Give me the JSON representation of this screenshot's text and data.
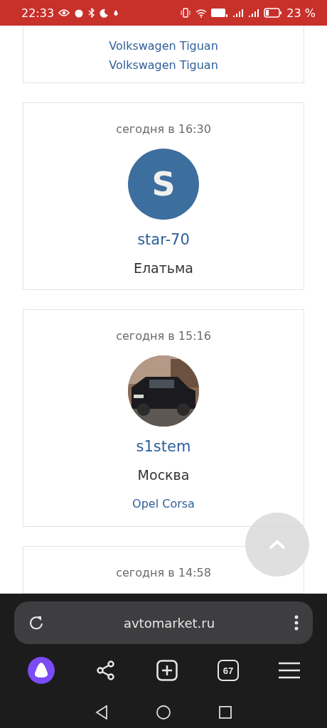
{
  "status_bar": {
    "time": "22:33",
    "battery_percent": "23 %"
  },
  "cards": [
    {
      "cars": [
        "Volkswagen Tiguan",
        "Volkswagen Tiguan"
      ]
    },
    {
      "date": "сегодня в 16:30",
      "avatar": {
        "kind": "letter",
        "letter": "S"
      },
      "username": "star-70",
      "city": "Елатьма"
    },
    {
      "date": "сегодня в 15:16",
      "avatar": {
        "kind": "picture"
      },
      "username": "s1stem",
      "city": "Москва",
      "cars": [
        "Opel Corsa"
      ]
    },
    {
      "date": "сегодня в 14:58"
    }
  ],
  "browser": {
    "url": "avtomarket.ru",
    "tab_count": "67"
  }
}
